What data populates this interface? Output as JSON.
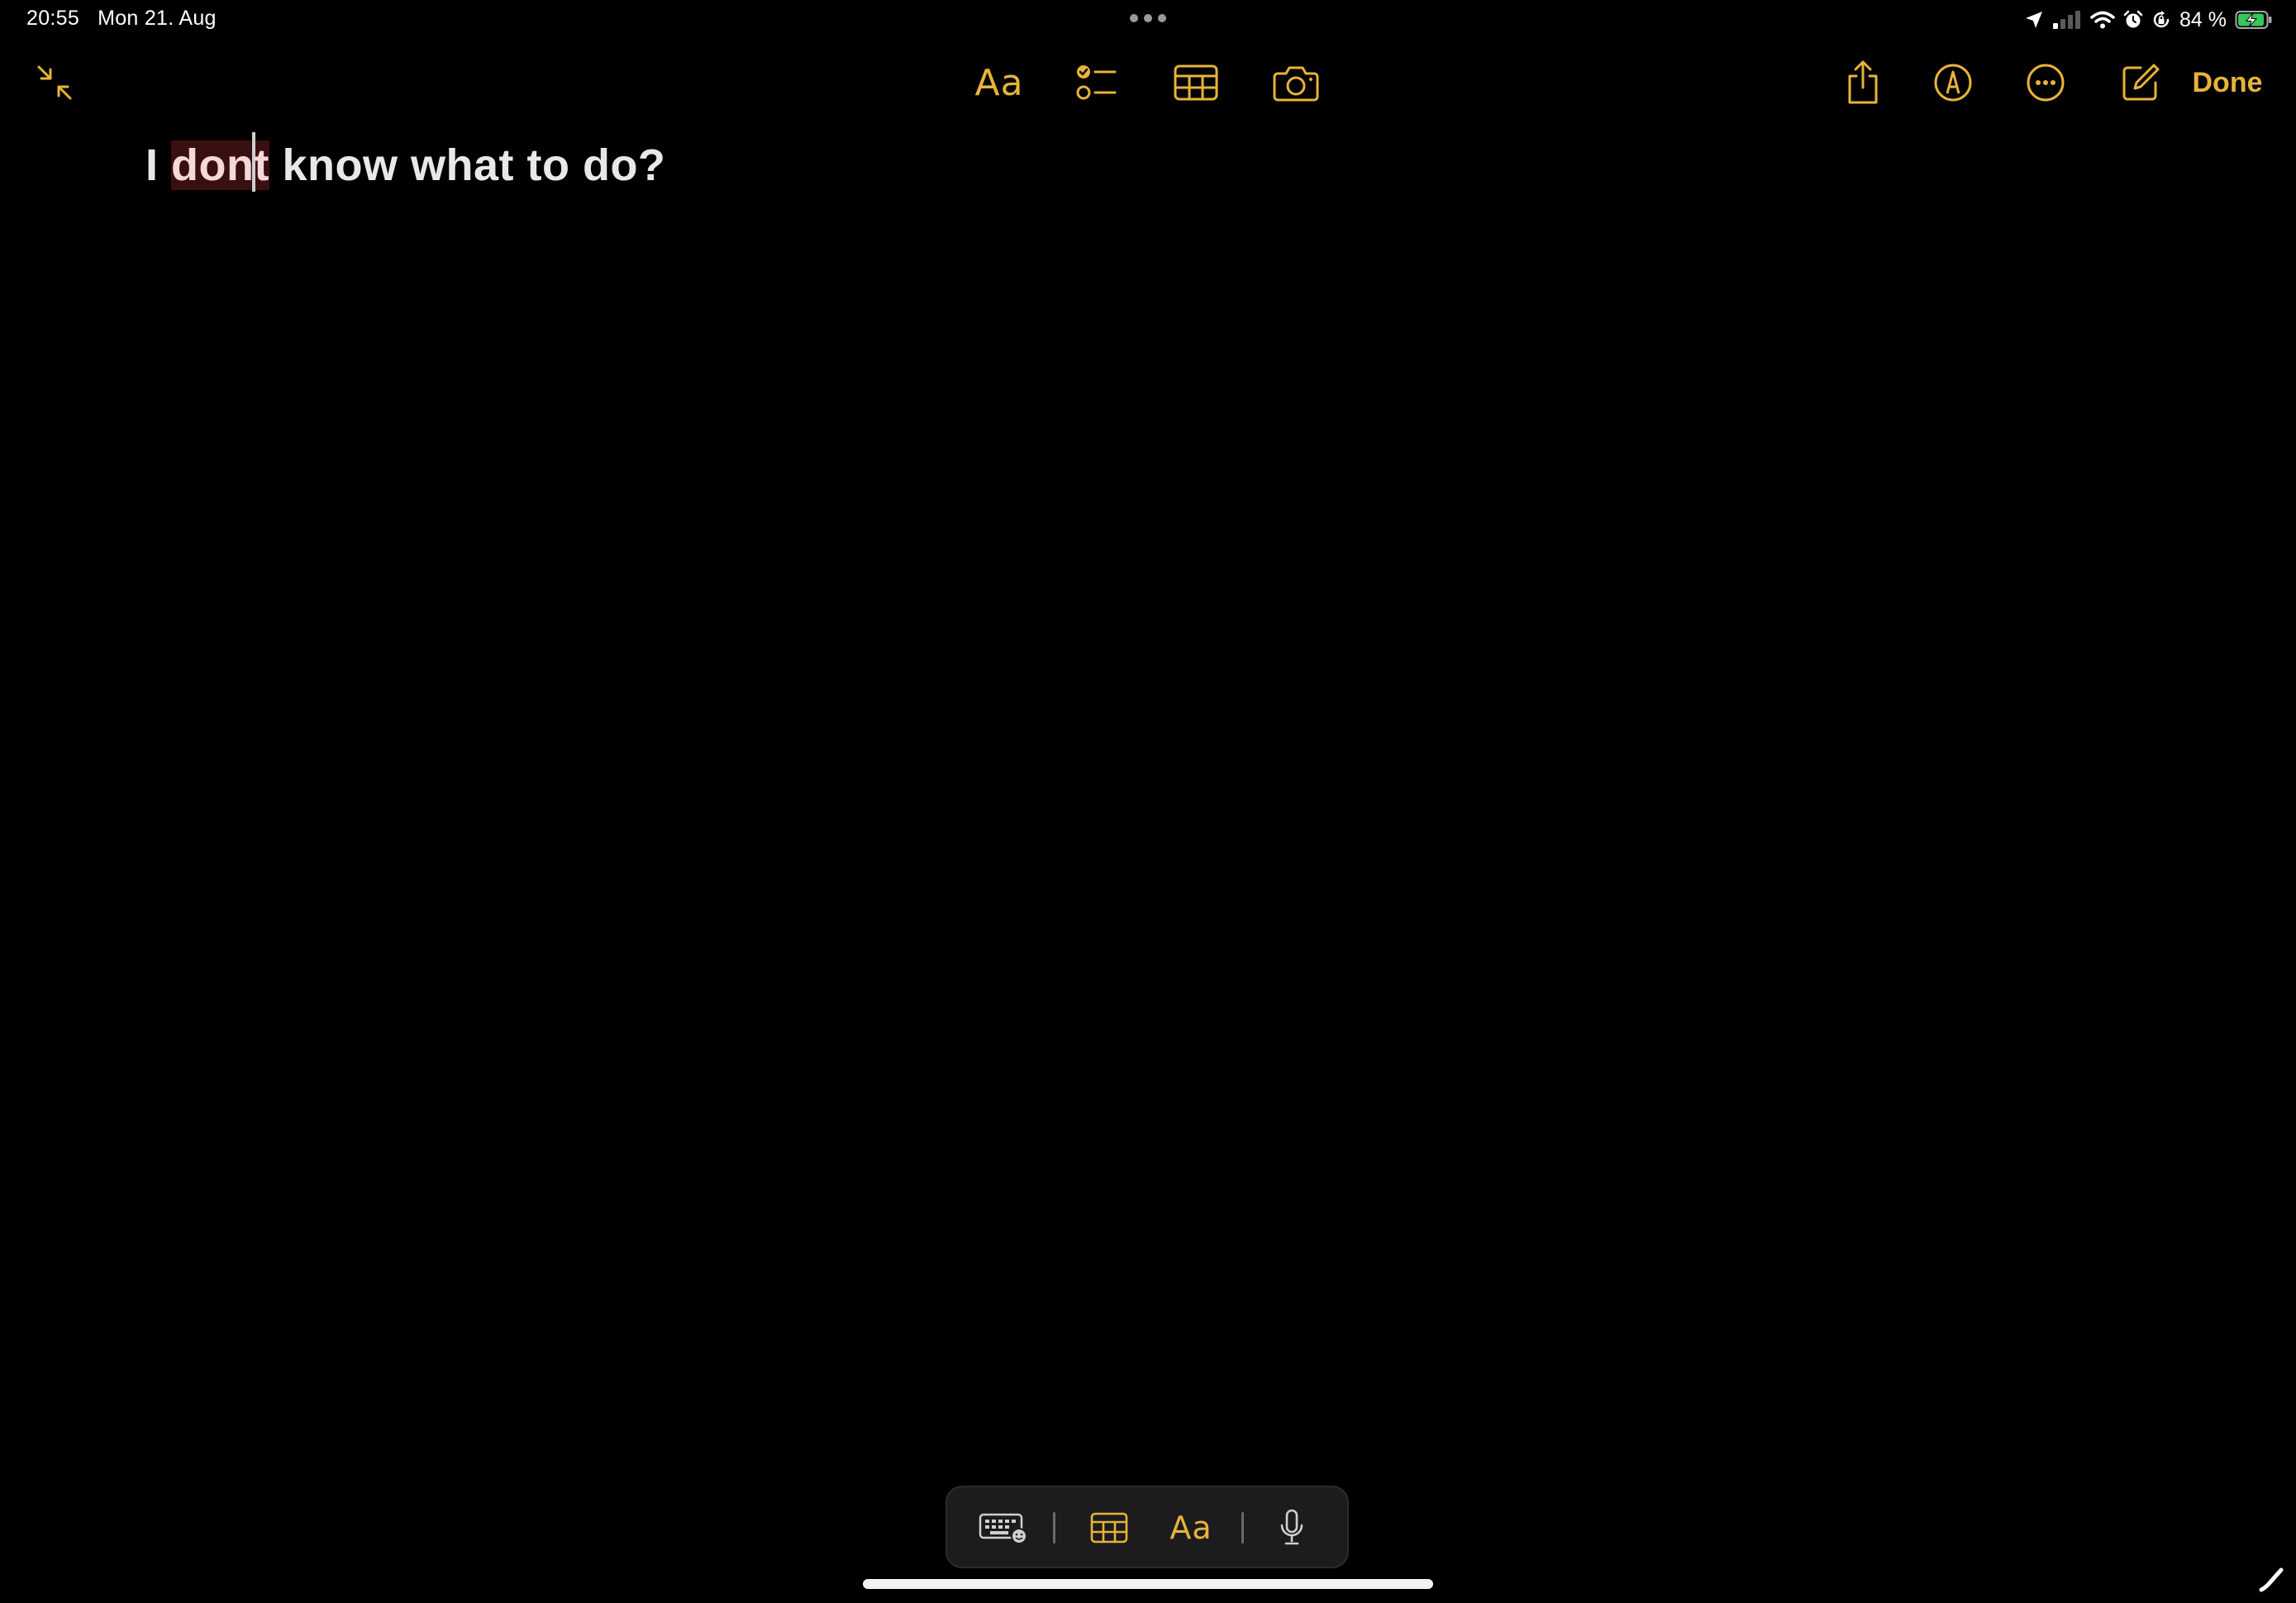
{
  "status_bar": {
    "time": "20:55",
    "date": "Mon 21. Aug",
    "battery_percent": "84 %",
    "icons": [
      "location-arrow-icon",
      "cellular-signal-icon",
      "wifi-icon",
      "alarm-icon",
      "orientation-lock-icon",
      "battery-charging-icon"
    ]
  },
  "toolbar": {
    "collapse_icon": "collapse-arrows-icon",
    "format_label": "Aa",
    "checklist_icon": "checklist-icon",
    "table_icon": "table-icon",
    "camera_icon": "camera-icon",
    "share_icon": "share-icon",
    "markup_icon": "markup-pen-icon",
    "more_icon": "more-ellipsis-icon",
    "compose_icon": "compose-icon",
    "done_label": "Done"
  },
  "note": {
    "text_before": "I ",
    "text_highlight_a": "don",
    "text_highlight_b": "t",
    "text_after": " know what to do?"
  },
  "shortcut_bar": {
    "keyboard_icon": "keyboard-emoji-icon",
    "table_icon": "table-icon",
    "format_label": "Aa",
    "dictation_icon": "microphone-icon"
  },
  "colors": {
    "accent": "#E8B33A",
    "background": "#000000",
    "misspelling_highlight": "#3a0f10"
  }
}
